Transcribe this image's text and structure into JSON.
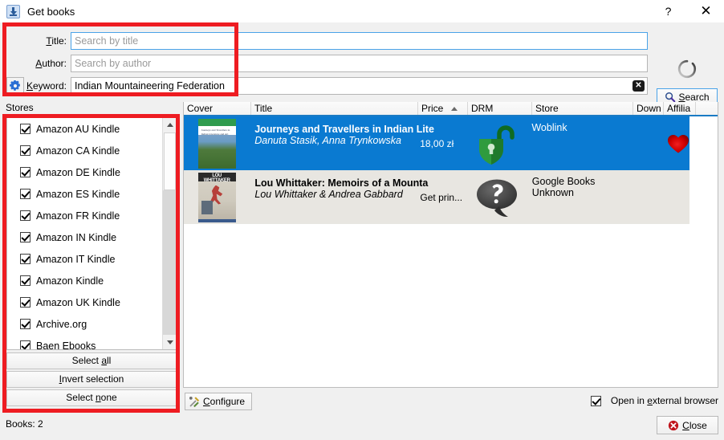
{
  "window": {
    "title": "Get books",
    "icon": "download-book-icon",
    "help_label": "?",
    "close_label": "✕"
  },
  "search": {
    "title_label": "Title:",
    "title_value": "",
    "title_placeholder": "Search by title",
    "author_label": "Author:",
    "author_value": "",
    "author_placeholder": "Search by author",
    "keyword_label": "Keyword:",
    "keyword_value": "Indian Mountaineering Federation",
    "keyword_placeholder": "",
    "clear_icon": "clear-x-icon",
    "gear_icon": "gear-icon",
    "spinner_icon": "loading-spinner-icon",
    "search_button": "Search",
    "search_icon": "magnifier-icon"
  },
  "stores": {
    "group_label": "Stores",
    "items": [
      {
        "label": "Amazon AU Kindle",
        "checked": true
      },
      {
        "label": "Amazon CA Kindle",
        "checked": true
      },
      {
        "label": "Amazon DE Kindle",
        "checked": true
      },
      {
        "label": "Amazon ES Kindle",
        "checked": true
      },
      {
        "label": "Amazon FR Kindle",
        "checked": true
      },
      {
        "label": "Amazon IN Kindle",
        "checked": true
      },
      {
        "label": "Amazon IT Kindle",
        "checked": true
      },
      {
        "label": "Amazon Kindle",
        "checked": true
      },
      {
        "label": "Amazon UK Kindle",
        "checked": true
      },
      {
        "label": "Archive.org",
        "checked": true
      },
      {
        "label": "Baen Ebooks",
        "checked": true
      }
    ],
    "select_all": "Select all",
    "invert_selection": "Invert selection",
    "select_none": "Select none"
  },
  "status": {
    "books_count": "Books:  2"
  },
  "table": {
    "columns": [
      {
        "key": "cover",
        "label": "Cover"
      },
      {
        "key": "title",
        "label": "Title"
      },
      {
        "key": "price",
        "label": "Price",
        "sorted": "asc"
      },
      {
        "key": "drm",
        "label": "DRM"
      },
      {
        "key": "store",
        "label": "Store"
      },
      {
        "key": "down",
        "label": "Down"
      },
      {
        "key": "affil",
        "label": "Affilia"
      }
    ],
    "rows": [
      {
        "selected": true,
        "cover_icon": "book-cover-journeys",
        "cover_top_text": "Journeys and Travellers in Indian Literature and Art",
        "title": "Journeys and Travellers in Indian Lite",
        "author": "Danuta Stasik, Anna Trynkowska",
        "price": "18,00 zł",
        "drm_icon": "unlocked-padlock-icon",
        "drm_status": "DRM free",
        "store": "Woblink",
        "store_sub": "",
        "down": "",
        "affiliate_icon": "red-heart-icon"
      },
      {
        "selected": false,
        "cover_icon": "book-cover-lou-whittaker",
        "cover_top_text": "LOU WHITTAKER",
        "title": "Lou Whittaker: Memoirs of a Mountа",
        "author": "Lou Whittaker & Andrea Gabbard",
        "price": "Get prin...",
        "drm_icon": "question-bubble-icon",
        "drm_status": "Unknown",
        "store": "Google Books",
        "store_sub": "Unknown",
        "down": "",
        "affiliate_icon": ""
      }
    ]
  },
  "footer": {
    "configure_label": "Configure",
    "configure_icon": "wrench-screwdriver-icon",
    "external_browser_label": "Open in external browser",
    "external_browser_checked": true,
    "close_label": "Close",
    "close_icon": "red-x-circle-icon"
  },
  "colors": {
    "selection_blue": "#0a7ad1",
    "highlight_red": "#ee1c22",
    "accent_blue": "#1a7bc4",
    "alt_row": "#e8e6e1"
  }
}
